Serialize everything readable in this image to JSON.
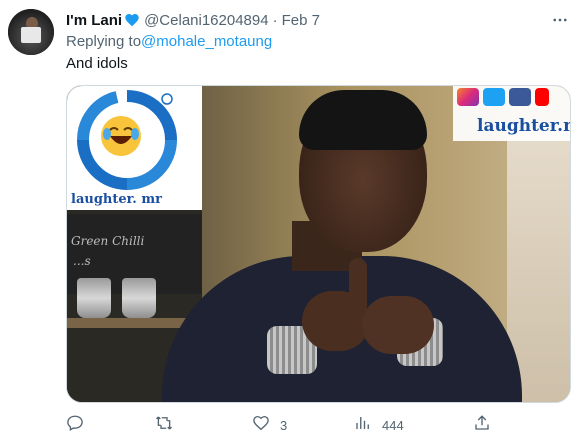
{
  "tweet": {
    "display_name": "I'm Lani",
    "handle": "@Celani16204894",
    "separator": "·",
    "date": "Feb 7",
    "replying_prefix": "Replying to",
    "replying_mention": "@mohale_motaung",
    "text": "And idols"
  },
  "media": {
    "logo_text": "laughter. mr",
    "watermark_text": "laughter.mr",
    "chalk_line_1": "Green Chilli",
    "chalk_line_2": "...s"
  },
  "actions": {
    "reply_count": "",
    "retweet_count": "",
    "like_count": "3",
    "views_count": "444"
  },
  "colors": {
    "verified": "#1d9bf0",
    "mention": "#1d9bf0",
    "muted": "#536471"
  },
  "icons": [
    "more-icon",
    "verified-badge-icon",
    "reply-icon",
    "retweet-icon",
    "like-icon",
    "views-icon",
    "share-icon"
  ]
}
